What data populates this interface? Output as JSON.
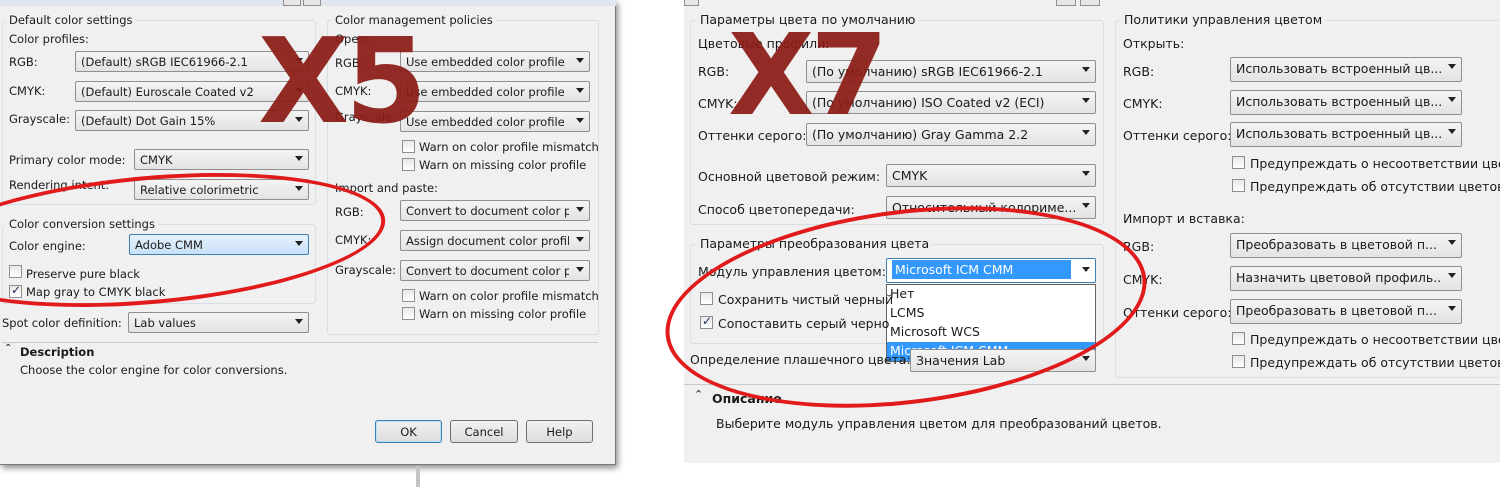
{
  "left": {
    "default_group": "Default color settings",
    "profiles_label": "Color profiles:",
    "rgb_label": "RGB:",
    "rgb_value": "(Default) sRGB IEC61966-2.1",
    "cmyk_label": "CMYK:",
    "cmyk_value": "(Default) Euroscale Coated v2",
    "gray_label": "Grayscale:",
    "gray_value": "(Default) Dot Gain 15%",
    "primary_label": "Primary color mode:",
    "primary_value": "CMYK",
    "intent_label": "Rendering intent:",
    "intent_value": "Relative colorimetric",
    "conv_group": "Color conversion settings",
    "engine_label": "Color engine:",
    "engine_value": "Adobe CMM",
    "preserve_label": "Preserve pure black",
    "map_gray_label": "Map gray to CMYK black",
    "spot_label": "Spot color definition:",
    "spot_value": "Lab values",
    "policy_group": "Color management policies",
    "open_label": "Open:",
    "p_rgb_label": "RGB:",
    "p_rgb_value": "Use embedded color profile",
    "p_cmyk_label": "CMYK:",
    "p_cmyk_value": "Use embedded color profile",
    "p_gray_label": "Grayscale:",
    "p_gray_value": "Use embedded color profile",
    "warn_mismatch": "Warn on color profile mismatch",
    "warn_missing": "Warn on missing color profile",
    "import_label": "Import and paste:",
    "i_rgb_label": "RGB:",
    "i_rgb_value": "Convert to document color p...",
    "i_cmyk_label": "CMYK:",
    "i_cmyk_value": "Assign document color profile",
    "i_gray_label": "Grayscale:",
    "i_gray_value": "Convert to document color p...",
    "warn_mismatch2": "Warn on color profile mismatch",
    "warn_missing2": "Warn on missing color profile",
    "desc_title": "Description",
    "desc_text": "Choose the color engine for color conversions.",
    "ok": "OK",
    "cancel": "Cancel",
    "help": "Help",
    "version_mark": "X5"
  },
  "right": {
    "default_group": "Параметры цвета по умолчанию",
    "profiles_label": "Цветовые профили:",
    "rgb_label": "RGB:",
    "rgb_value": "(По умолчанию) sRGB IEC61966-2.1",
    "cmyk_label": "CMYK:",
    "cmyk_value": "(По умолчанию) ISO Coated v2 (ECI)",
    "gray_label": "Оттенки серого:",
    "gray_value": "(По умолчанию) Gray Gamma 2.2",
    "primary_label": "Основной цветовой режим:",
    "primary_value": "CMYK",
    "intent_label": "Способ цветопередачи:",
    "intent_value": "Относительный колориме...",
    "conv_group": "Параметры преобразования цвета",
    "engine_label": "Модуль управления цветом:",
    "engine_value": "Microsoft ICM CMM",
    "engine_options": [
      "Нет",
      "LCMS",
      "Microsoft WCS",
      "Microsoft ICM CMM"
    ],
    "preserve_label": "Сохранить чистый черный",
    "map_gray_label": "Сопоставить серый черно",
    "spot_label": "Определение плашечного цвета:",
    "spot_value": "Значения Lab",
    "policy_group": "Политики управления цветом",
    "open_label": "Открыть:",
    "p_rgb_label": "RGB:",
    "p_rgb_value": "Использовать встроенный цв...",
    "p_cmyk_label": "CMYK:",
    "p_cmyk_value": "Использовать встроенный цв...",
    "p_gray_label": "Оттенки серого:",
    "p_gray_value": "Использовать встроенный цв...",
    "warn_mismatch": "Предупреждать о несоответствии цвет",
    "warn_missing": "Предупреждать об отсутствии цветово",
    "import_label": "Импорт и вставка:",
    "i_rgb_label": "RGB:",
    "i_rgb_value": "Преобразовать в цветовой п...",
    "i_cmyk_label": "CMYK:",
    "i_cmyk_value": "Назначить цветовой профиль...",
    "i_gray_label": "Оттенки серого:",
    "i_gray_value": "Преобразовать в цветовой п...",
    "warn_mismatch2": "Предупреждать о несоответствии цвет",
    "warn_missing2": "Предупреждать об отсутствии цветово",
    "desc_title": "Описание",
    "desc_text": "Выберите модуль управления цветом для преобразований цветов.",
    "version_mark": "X7"
  }
}
